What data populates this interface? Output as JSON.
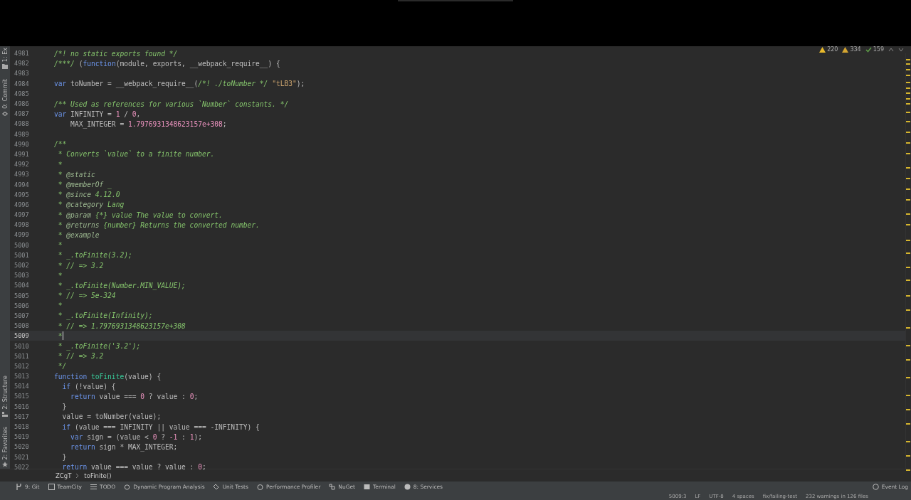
{
  "tool_strip": [
    {
      "label": "1: Ex"
    },
    {
      "label": "0: Commit"
    }
  ],
  "tool_strip_bottom": [
    {
      "label": "2: Structure"
    },
    {
      "label": "2: Favorites"
    }
  ],
  "inspections": [
    {
      "kind": "warning",
      "count": "220"
    },
    {
      "kind": "weak",
      "count": "334"
    },
    {
      "kind": "ok",
      "count": "159"
    }
  ],
  "lines": [
    {
      "number": "4981",
      "current": false,
      "tokens": [
        {
          "kind": "comment",
          "t": "/*! no static exports found */"
        }
      ]
    },
    {
      "number": "4982",
      "current": false,
      "tokens": [
        {
          "kind": "comment",
          "t": "/***/"
        },
        {
          "kind": "plain",
          "t": " ("
        },
        {
          "kind": "kw",
          "t": "function"
        },
        {
          "kind": "plain",
          "t": "(module, exports, __webpack_require__) {"
        }
      ]
    },
    {
      "number": "4983",
      "current": false
    },
    {
      "number": "4984",
      "current": false,
      "tokens": [
        {
          "kind": "kw",
          "t": "var"
        },
        {
          "kind": "plain",
          "t": " toNumber = __webpack_require__("
        },
        {
          "kind": "comment",
          "t": "/*! ./toNumber */"
        },
        {
          "kind": "str",
          "t": " \"tLB3\""
        },
        {
          "kind": "plain",
          "t": ");"
        }
      ]
    },
    {
      "number": "4985",
      "current": false
    },
    {
      "number": "4986",
      "current": false,
      "tokens": [
        {
          "kind": "comment",
          "t": "/** Used as references for various `Number` constants. */"
        }
      ]
    },
    {
      "number": "4987",
      "current": false,
      "tokens": [
        {
          "kind": "kw",
          "t": "var"
        },
        {
          "kind": "plain",
          "t": " INFINITY = "
        },
        {
          "kind": "num",
          "t": "1"
        },
        {
          "kind": "plain",
          "t": " / "
        },
        {
          "kind": "num",
          "t": "0"
        },
        {
          "kind": "plain",
          "t": ","
        }
      ]
    },
    {
      "number": "4988",
      "current": false,
      "tokens": [
        {
          "kind": "plain",
          "t": "    MAX_INTEGER = "
        },
        {
          "kind": "num",
          "t": "1.7976931348623157e+308"
        },
        {
          "kind": "plain",
          "t": ";"
        }
      ]
    },
    {
      "number": "4989",
      "current": false
    },
    {
      "number": "4990",
      "current": false,
      "tokens": [
        {
          "kind": "comment",
          "t": "/**"
        }
      ]
    },
    {
      "number": "4991",
      "current": false,
      "tokens": [
        {
          "kind": "comment",
          "t": " * Converts `value` to a finite number."
        }
      ]
    },
    {
      "number": "4992",
      "current": false,
      "tokens": [
        {
          "kind": "comment",
          "t": " *"
        }
      ]
    },
    {
      "number": "4993",
      "current": false,
      "tokens": [
        {
          "kind": "comment",
          "t": " *"
        },
        {
          "kind": "tag",
          "t": " @static"
        }
      ]
    },
    {
      "number": "4994",
      "current": false,
      "tokens": [
        {
          "kind": "comment",
          "t": " *"
        },
        {
          "kind": "tag",
          "t": " @memberOf"
        },
        {
          "kind": "comment",
          "t": " _"
        }
      ]
    },
    {
      "number": "4995",
      "current": false,
      "tokens": [
        {
          "kind": "comment",
          "t": " *"
        },
        {
          "kind": "tag",
          "t": " @since"
        },
        {
          "kind": "comment",
          "t": " 4.12.0"
        }
      ]
    },
    {
      "number": "4996",
      "current": false,
      "tokens": [
        {
          "kind": "comment",
          "t": " *"
        },
        {
          "kind": "tag",
          "t": " @category"
        },
        {
          "kind": "comment",
          "t": " Lang"
        }
      ]
    },
    {
      "number": "4997",
      "current": false,
      "tokens": [
        {
          "kind": "comment",
          "t": " *"
        },
        {
          "kind": "tag",
          "t": " @param"
        },
        {
          "kind": "comment",
          "t": " {*} value The value to convert."
        }
      ]
    },
    {
      "number": "4998",
      "current": false,
      "tokens": [
        {
          "kind": "comment",
          "t": " *"
        },
        {
          "kind": "tag",
          "t": " @returns"
        },
        {
          "kind": "comment",
          "t": " {number} Returns the converted number."
        }
      ]
    },
    {
      "number": "4999",
      "current": false,
      "tokens": [
        {
          "kind": "comment",
          "t": " *"
        },
        {
          "kind": "tag",
          "t": " @example"
        }
      ]
    },
    {
      "number": "5000",
      "current": false,
      "tokens": [
        {
          "kind": "comment",
          "t": " *"
        }
      ]
    },
    {
      "number": "5001",
      "current": false,
      "tokens": [
        {
          "kind": "comment",
          "t": " * _.toFinite(3.2);"
        }
      ]
    },
    {
      "number": "5002",
      "current": false,
      "tokens": [
        {
          "kind": "comment",
          "t": " * // => 3.2"
        }
      ]
    },
    {
      "number": "5003",
      "current": false,
      "tokens": [
        {
          "kind": "comment",
          "t": " *"
        }
      ]
    },
    {
      "number": "5004",
      "current": false,
      "tokens": [
        {
          "kind": "comment",
          "t": " * _.toFinite(Number.MIN_VALUE);"
        }
      ]
    },
    {
      "number": "5005",
      "current": false,
      "tokens": [
        {
          "kind": "comment",
          "t": " * // => 5e-324"
        }
      ]
    },
    {
      "number": "5006",
      "current": false,
      "tokens": [
        {
          "kind": "comment",
          "t": " *"
        }
      ]
    },
    {
      "number": "5007",
      "current": false,
      "tokens": [
        {
          "kind": "comment",
          "t": " * _.toFinite(Infinity);"
        }
      ]
    },
    {
      "number": "5008",
      "current": false,
      "tokens": [
        {
          "kind": "comment",
          "t": " * // => 1.7976931348623157e+308"
        }
      ]
    },
    {
      "number": "5009",
      "current": true,
      "tokens": [
        {
          "kind": "comment",
          "t": " *"
        }
      ]
    },
    {
      "number": "5010",
      "current": false,
      "tokens": [
        {
          "kind": "comment",
          "t": " * _.toFinite('3.2');"
        }
      ]
    },
    {
      "number": "5011",
      "current": false,
      "tokens": [
        {
          "kind": "comment",
          "t": " * // => 3.2"
        }
      ]
    },
    {
      "number": "5012",
      "current": false,
      "tokens": [
        {
          "kind": "comment",
          "t": " */"
        }
      ]
    },
    {
      "number": "5013",
      "current": false,
      "tokens": [
        {
          "kind": "kw",
          "t": "function"
        },
        {
          "kind": "fn",
          "t": " toFinite"
        },
        {
          "kind": "plain",
          "t": "(value) {"
        }
      ]
    },
    {
      "number": "5014",
      "current": false,
      "tokens": [
        {
          "kind": "kw",
          "t": "  if"
        },
        {
          "kind": "plain",
          "t": " (!value) {"
        }
      ]
    },
    {
      "number": "5015",
      "current": false,
      "tokens": [
        {
          "kind": "kw",
          "t": "    return"
        },
        {
          "kind": "plain",
          "t": " value === "
        },
        {
          "kind": "num",
          "t": "0"
        },
        {
          "kind": "plain",
          "t": " ? value : "
        },
        {
          "kind": "num",
          "t": "0"
        },
        {
          "kind": "plain",
          "t": ";"
        }
      ]
    },
    {
      "number": "5016",
      "current": false,
      "tokens": [
        {
          "kind": "plain",
          "t": "  }"
        }
      ]
    },
    {
      "number": "5017",
      "current": false,
      "tokens": [
        {
          "kind": "plain",
          "t": "  value = toNumber(value);"
        }
      ]
    },
    {
      "number": "5018",
      "current": false,
      "tokens": [
        {
          "kind": "kw",
          "t": "  if"
        },
        {
          "kind": "plain",
          "t": " (value === INFINITY || value === -INFINITY) {"
        }
      ]
    },
    {
      "number": "5019",
      "current": false,
      "tokens": [
        {
          "kind": "kw",
          "t": "    var"
        },
        {
          "kind": "plain",
          "t": " sign = (value < "
        },
        {
          "kind": "num",
          "t": "0"
        },
        {
          "kind": "plain",
          "t": " ? "
        },
        {
          "kind": "num",
          "t": "-1"
        },
        {
          "kind": "plain",
          "t": " : "
        },
        {
          "kind": "num",
          "t": "1"
        },
        {
          "kind": "plain",
          "t": ");"
        }
      ]
    },
    {
      "number": "5020",
      "current": false,
      "tokens": [
        {
          "kind": "kw",
          "t": "    return"
        },
        {
          "kind": "plain",
          "t": " sign * MAX_INTEGER;"
        }
      ]
    },
    {
      "number": "5021",
      "current": false,
      "tokens": [
        {
          "kind": "plain",
          "t": "  }"
        }
      ]
    },
    {
      "number": "5022",
      "current": false,
      "tokens": [
        {
          "kind": "kw",
          "t": "  return"
        },
        {
          "kind": "plain",
          "t": " value === value ? value : "
        },
        {
          "kind": "num",
          "t": "0"
        },
        {
          "kind": "plain",
          "t": ";"
        }
      ]
    }
  ],
  "breadcrumbs": [
    "ZCgT",
    "toFinite()"
  ],
  "tool_windows": [
    "9: Git",
    "TeamCity",
    "TODO",
    "Dynamic Program Analysis",
    "Unit Tests",
    "Performance Profiler",
    "NuGet",
    "Terminal",
    "8: Services"
  ],
  "event_log": "Event Log",
  "status_bar": [
    "5009:3",
    "LF",
    "UTF-8",
    "4 spaces",
    "fix/failing-test",
    "232 warnings in 126 files"
  ]
}
